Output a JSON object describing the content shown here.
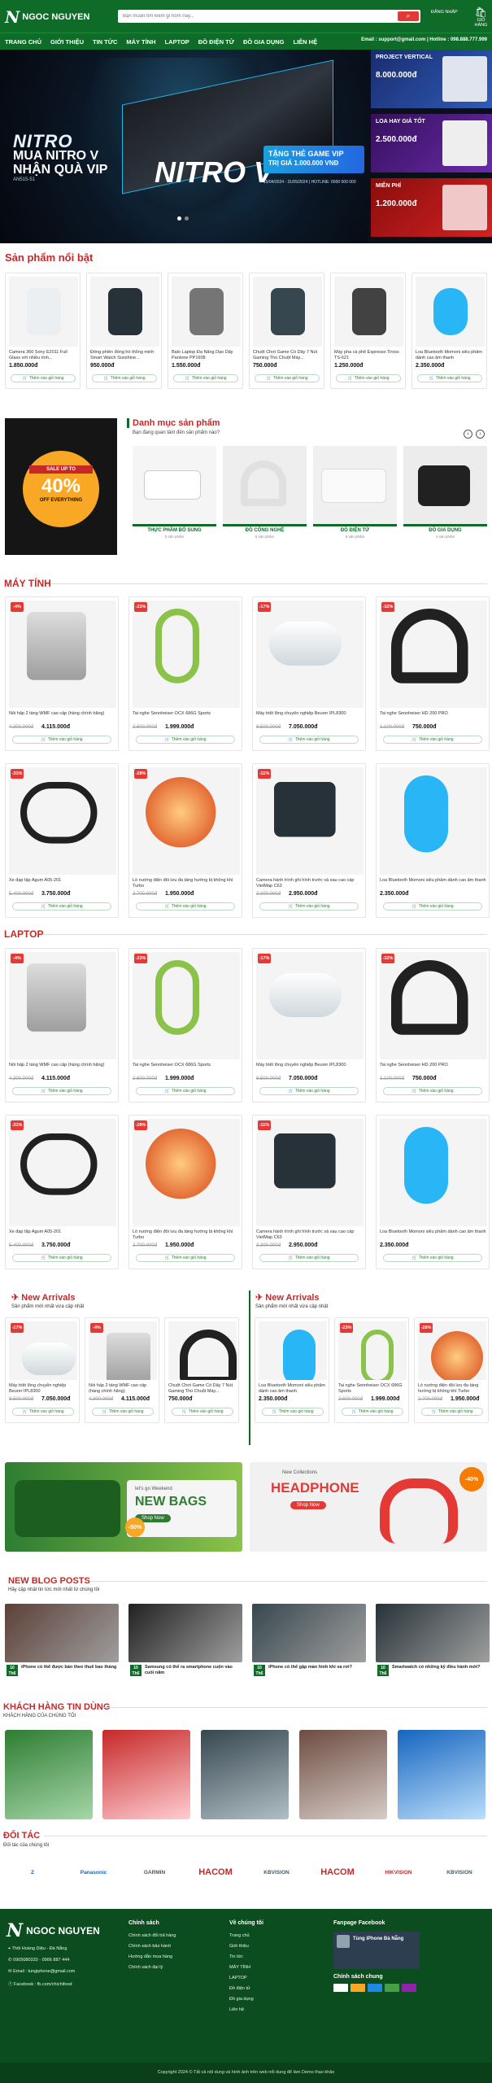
{
  "header": {
    "logo": "NGOC NGUYEN",
    "search_placeholder": "Bạn muốn tìm kiếm gì hôm nay...",
    "login": "ĐĂNG NHẬP",
    "cart": "GIỎ HÀNG"
  },
  "nav": [
    "TRANG CHỦ",
    "GIỚI THIỆU",
    "TIN TỨC",
    "MÁY TÍNH",
    "LAPTOP",
    "ĐỒ ĐIỆN TỬ",
    "ĐỒ GIA DỤNG",
    "LIÊN HỆ"
  ],
  "contact": "Email : support@gmail.com | Hotline : 098.888.777.999",
  "banner": {
    "brand": "NITRO",
    "line": "MUA NITRO V NHẬN QUÀ VIP",
    "model": "AN515-51",
    "nitro_v": "NITRO V",
    "gift": "TẶNG THẺ GAME VIP",
    "gift_value": "TRỊ GIÁ 1.000.000 VNĐ",
    "date": "15/04/2024 - 31/05/2024  |  HOTLINE: 0000 000 000",
    "side": [
      {
        "title": "PROJECT VERTICAL",
        "price": "8.000.000đ"
      },
      {
        "title": "LOA HAY GIÁ TỐT",
        "price": "2.500.000đ"
      },
      {
        "title": "MIỄN PHÍ",
        "price": "1.200.000đ"
      }
    ]
  },
  "featured": {
    "title": "Sản phẩm nổi bật",
    "add": "Thêm vào giỏ hàng",
    "items": [
      {
        "name": "Camera 360 Sony E2011 Full Glass với nhiều tính...",
        "price": "1.850.000đ"
      },
      {
        "name": "Đồng phiên đồng hồ thông minh Smart Watch Sunshine...",
        "price": "950.000đ"
      },
      {
        "name": "Balo Laptop Đa Năng Dạo Dây Pantone PP1608",
        "price": "1.550.000đ"
      },
      {
        "name": "Chuột Chơi Game Có Dây 7 Nút Gaming Thú Chuột Máy...",
        "price": "750.000đ"
      },
      {
        "name": "Máy pha cà phê Espresso Tiross TS-621",
        "price": "1.250.000đ"
      },
      {
        "name": "Loa Bluetooth Momoni siêu phẩm dành cao âm thanh",
        "price": "2.350.000đ"
      }
    ]
  },
  "promo": {
    "tag": "SALE UP TO",
    "percent": "40%",
    "off": "OFF EVERYTHING"
  },
  "categories": {
    "title": "Danh mục sản phẩm",
    "sub": "Bạn đang quan tâm đến sản phẩm nào?",
    "items": [
      {
        "name": "THỰC PHẨM BỔ SUNG",
        "count": "0 sản phẩm"
      },
      {
        "name": "ĐỒ CÔNG NGHỆ",
        "count": "6 sản phẩm"
      },
      {
        "name": "ĐỒ ĐIỆN TỬ",
        "count": "6 sản phẩm"
      },
      {
        "name": "ĐỒ GIA DỤNG",
        "count": "4 sản phẩm"
      }
    ]
  },
  "computers": {
    "title": "MÁY TÍNH"
  },
  "laptops": {
    "title": "LAPTOP"
  },
  "products": [
    {
      "name": "Nồi hấp 2 tầng WMF cao cấp (hàng chính hãng)",
      "old": "4.300.000đ",
      "price": "4.115.000đ",
      "badge": "-4%"
    },
    {
      "name": "Tai nghe Sennheiser OCX 686G Sports",
      "old": "2.600.000đ",
      "price": "1.999.000đ",
      "badge": "-23%"
    },
    {
      "name": "Máy triệt lông chuyên nghiệp Beurer IPL8300",
      "old": "8.500.000đ",
      "price": "7.050.000đ",
      "badge": "-17%"
    },
    {
      "name": "Tai nghe Sennheiser HD 200 PRO",
      "old": "1.100.000đ",
      "price": "750.000đ",
      "badge": "-32%"
    },
    {
      "name": "Xe đạp tập Agum A05-201",
      "old": "5.400.000đ",
      "price": "3.750.000đ",
      "badge": "-31%"
    },
    {
      "name": "Lò nướng điện đối lưu đa tầng hướng bị không khí Turbo",
      "old": "2.700.000đ",
      "price": "1.950.000đ",
      "badge": "-28%"
    },
    {
      "name": "Camera hành trình ghi hình trước và sau cao cấp VietMap C63",
      "old": "3.300.000đ",
      "price": "2.950.000đ",
      "badge": "-11%"
    },
    {
      "name": "Loa Bluetooth Momoni siêu phẩm dành cao âm thanh",
      "old": "",
      "price": "2.350.000đ",
      "badge": ""
    }
  ],
  "arrivals": {
    "title": "New Arrivals",
    "sub": "Sản phẩm mới nhất vừa cập nhật",
    "left": [
      {
        "name": "Máy triệt lông chuyên nghiệp Beurer IPL8300",
        "old": "8.500.000đ",
        "price": "7.050.000đ",
        "badge": "-17%"
      },
      {
        "name": "Nồi hấp 2 tầng WMF cao cấp (hàng chính hãng)",
        "old": "4.300.000đ",
        "price": "4.115.000đ",
        "badge": "-4%"
      },
      {
        "name": "Chuột Chơi Game Có Dây 7 Nút Gaming Thú Chuột Máy...",
        "old": "",
        "price": "750.000đ",
        "badge": ""
      }
    ],
    "right": [
      {
        "name": "Loa Bluetooth Momoni siêu phẩm dành cao âm thanh",
        "old": "",
        "price": "2.350.000đ",
        "badge": ""
      },
      {
        "name": "Tai nghe Sennheiser OCX 686G Sports",
        "old": "2.600.000đ",
        "price": "1.999.000đ",
        "badge": "-23%"
      },
      {
        "name": "Lò nướng điện đối lưu đa tầng hướng bị không khí Turbo",
        "old": "2.700.000đ",
        "price": "1.950.000đ",
        "badge": "-28%"
      }
    ]
  },
  "ads": [
    {
      "small": "let's go Weekend",
      "big": "NEW BAGS",
      "btn": "Shop Now",
      "pct": "-50%"
    },
    {
      "small": "New Collections",
      "big": "HEADPHONE",
      "btn": "Shop Now",
      "pct": "-40%"
    }
  ],
  "blog": {
    "title": "NEW BLOG POSTS",
    "sub": "Hãy cập nhật tin tức mới nhất từ chúng tôi",
    "posts": [
      {
        "d": "10",
        "m": "Th6",
        "title": "iPhone có thể được bán theo thuê bao tháng"
      },
      {
        "d": "10",
        "m": "Th6",
        "title": "Samsung có thể ra smartphone cuộn vào cuối năm"
      },
      {
        "d": "10",
        "m": "Th6",
        "title": "iPhone có thể gập màn hình khi va rơi?"
      },
      {
        "d": "10",
        "m": "Th6",
        "title": "Smartwatch có những kỹ điều hành mới?"
      }
    ]
  },
  "customers": {
    "title": "KHÁCH HÀNG TIN DÙNG",
    "sub": "KHÁCH HÀNG CỦA CHÚNG TÔI"
  },
  "partners": {
    "title": "ĐỐI TÁC",
    "sub": "Đối tác của chúng tôi",
    "items": [
      "Z",
      "Panasonic",
      "GARMIN",
      "HACOM",
      "KBVISION",
      "HACOM",
      "HIKVISION",
      "KBVISION"
    ]
  },
  "footer": {
    "logo": "NGOC NGUYEN",
    "address": "Thôi Hoàng Diệu - Đà Nẵng",
    "phone": "0905080333 - 0966 887 444",
    "email": "Email : tungiphone@gmail.com",
    "facebook": "Facebook : fb.com/chichifood",
    "policy_title": "Chính sách",
    "policy": [
      "Chính sách đổi trả hàng",
      "Chính sách bảo hành",
      "Hướng dẫn mua hàng",
      "Chính sách đại lý"
    ],
    "about_title": "Về chúng tôi",
    "about": [
      "Trang chủ",
      "Giới thiệu",
      "Tin tức",
      "MÁY TÍNH",
      "LAPTOP",
      "Đồ điện tử",
      "Đồ gia dụng",
      "Liên hệ"
    ],
    "fanpage_title": "Fanpage Facebook",
    "fanpage_name": "Tùng iPhone Đà Nẵng",
    "payment_title": "Chính sách chung",
    "copyright": "Copyright 2024 © Tất cả nội dung và hình ảnh trên web nổi dung để làm Demo thao khảo"
  },
  "colors": {
    "brand": "#0e6b28",
    "accent": "#c62828"
  }
}
